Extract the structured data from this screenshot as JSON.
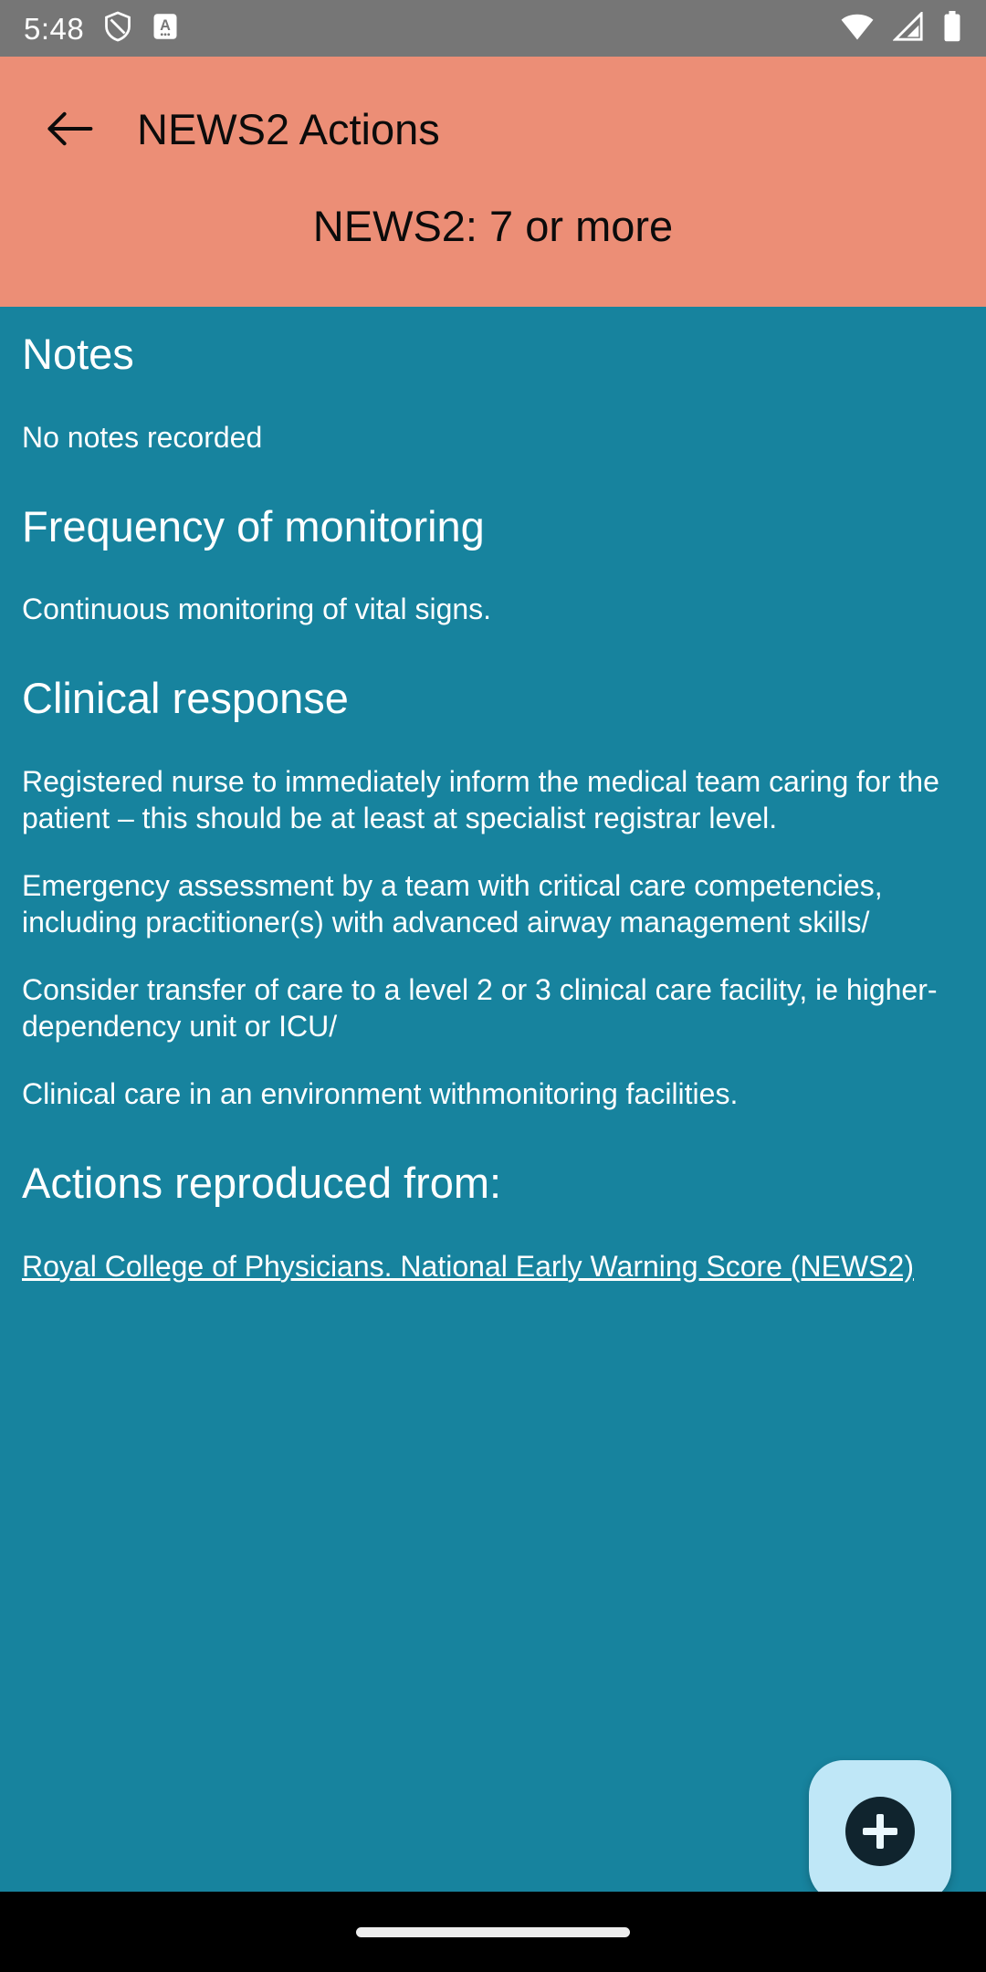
{
  "status_bar": {
    "time": "5:48",
    "icons_left": [
      "shield-icon",
      "app-badge-a-icon"
    ],
    "icons_right": [
      "wifi-icon",
      "cellular-signal-icon",
      "battery-icon"
    ],
    "background_color": "#767676"
  },
  "app_bar": {
    "back_label": "Back",
    "title": "NEWS2 Actions",
    "subtitle": "NEWS2: 7 or more",
    "background_color": "#EC8E76",
    "text_color": "#0B0B0B"
  },
  "content": {
    "background_color": "#17839E",
    "text_color": "#FFFFFF",
    "sections": [
      {
        "heading": "Notes",
        "paragraphs": [
          "No notes recorded"
        ]
      },
      {
        "heading": "Frequency of monitoring",
        "paragraphs": [
          "Continuous monitoring of vital signs."
        ]
      },
      {
        "heading": "Clinical response",
        "paragraphs": [
          "Registered nurse to immediately inform the medical team caring for the patient – this should be at least at specialist registrar level.",
          "Emergency assessment by a team with critical care competencies, including practitioner(s) with advanced airway management skills/",
          "Consider transfer of care to a level 2 or 3 clinical care facility, ie higher-dependency unit or ICU/",
          "Clinical care in an environment withmonitoring facilities."
        ]
      },
      {
        "heading": "Actions reproduced from:",
        "link_text": "Royal College of Physicians. National Early Warning Score (NEWS2)"
      }
    ]
  },
  "fab": {
    "icon": "plus-icon",
    "label": "Add",
    "background_color": "#BFE7F7",
    "icon_circle_color": "#10242E"
  },
  "nav_bar": {
    "home_indicator": "home-indicator",
    "background_color": "#000000"
  }
}
